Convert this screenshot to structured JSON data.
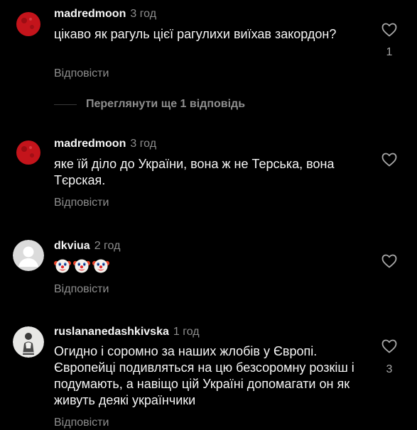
{
  "comments": [
    {
      "username": "madredmoon",
      "time": "3 год",
      "text": "цікаво як рагуль цієї рагулихи виїхав закордон?",
      "reply_label": "Відповісти",
      "like_count": "1",
      "avatar_icon": "red-moon-avatar-icon"
    },
    {
      "username": "madredmoon",
      "time": "3 год",
      "text": "яке їй діло до України, вона ж не Терська, вона Тєрская.",
      "reply_label": "Відповісти",
      "like_count": "",
      "avatar_icon": "red-moon-avatar-icon"
    },
    {
      "username": "dkviua",
      "time": "2 год",
      "text": "",
      "emoji": [
        "clown-face-icon",
        "clown-face-icon",
        "clown-face-icon"
      ],
      "reply_label": "Відповісти",
      "like_count": "",
      "avatar_icon": "default-user-avatar-icon"
    },
    {
      "username": "ruslananedashkivska",
      "time": "1 год",
      "text": "Огидно і соромно за наших жлобів у Європі. Європейці подивляться на цю безсоромну розкіш і подумають, а навіщо цій Україні допомагати он як живуть деякі українчики",
      "reply_label": "Відповісти",
      "like_count": "3",
      "avatar_icon": "photo-avatar-icon"
    }
  ],
  "view_replies": {
    "label": "Переглянути ще 1 відповідь"
  },
  "icons": {
    "like": "heart-outline-icon"
  },
  "colors": {
    "background": "#000000",
    "text_primary": "#f5f5f5",
    "text_secondary": "#8e8e8e",
    "moon_red": "#c4141b"
  }
}
